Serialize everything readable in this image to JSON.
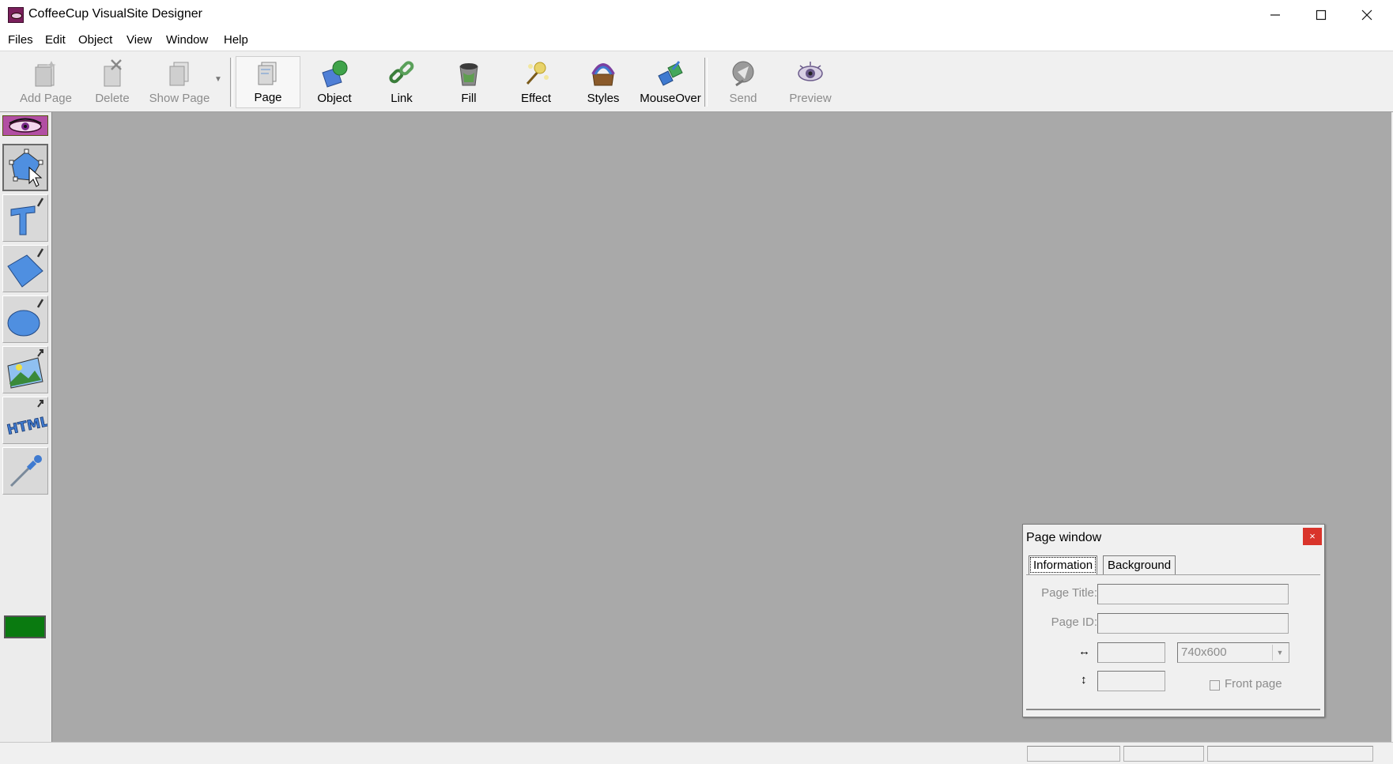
{
  "window": {
    "title": "CoffeeCup VisualSite Designer",
    "controls": [
      "minimize",
      "maximize",
      "close"
    ]
  },
  "menu": [
    "Files",
    "Edit",
    "Object",
    "View",
    "Window",
    "Help"
  ],
  "toolbar": {
    "buttons": [
      {
        "label": "Add Page",
        "icon": "add-page-icon",
        "enabled": false
      },
      {
        "label": "Delete",
        "icon": "delete-icon",
        "enabled": false
      },
      {
        "label": "Show Page",
        "icon": "show-page-icon",
        "enabled": false
      },
      {
        "label": "Page",
        "icon": "page-icon",
        "enabled": true,
        "pressed": true
      },
      {
        "label": "Object",
        "icon": "object-icon",
        "enabled": true
      },
      {
        "label": "Link",
        "icon": "link-chain-icon",
        "enabled": true
      },
      {
        "label": "Fill",
        "icon": "fill-bucket-icon",
        "enabled": true
      },
      {
        "label": "Effect",
        "icon": "effect-sparkle-icon",
        "enabled": true
      },
      {
        "label": "Styles",
        "icon": "styles-box-icon",
        "enabled": true
      },
      {
        "label": "MouseOver",
        "icon": "mouseover-icon",
        "enabled": true
      },
      {
        "label": "Send",
        "icon": "send-icon",
        "enabled": false
      },
      {
        "label": "Preview",
        "icon": "preview-eye-icon",
        "enabled": false
      }
    ]
  },
  "tools": [
    {
      "name": "select-tool",
      "icon": "select-arrow-icon",
      "active": true
    },
    {
      "name": "text-tool",
      "icon": "text-T-icon"
    },
    {
      "name": "rectangle-tool",
      "icon": "rectangle-icon"
    },
    {
      "name": "ellipse-tool",
      "icon": "ellipse-icon"
    },
    {
      "name": "image-tool",
      "icon": "image-icon"
    },
    {
      "name": "html-tool",
      "icon": "html-icon"
    },
    {
      "name": "eyedropper-tool",
      "icon": "eyedropper-icon"
    }
  ],
  "colors": {
    "canvas": "#a9a9a9",
    "current_color": "#0a7a10",
    "close_red": "#d9342b"
  },
  "page_window": {
    "title": "Page window",
    "close": "×",
    "tabs": [
      "Information",
      "Background"
    ],
    "active_tab": "Information",
    "page_title_label": "Page Title:",
    "page_title_value": "",
    "page_id_label": "Page ID:",
    "page_id_value": "",
    "width_symbol": "↔",
    "height_symbol": "↕",
    "width_value": "",
    "height_value": "",
    "size_preset": "740x600",
    "front_page_label": "Front page",
    "front_page_checked": false
  }
}
